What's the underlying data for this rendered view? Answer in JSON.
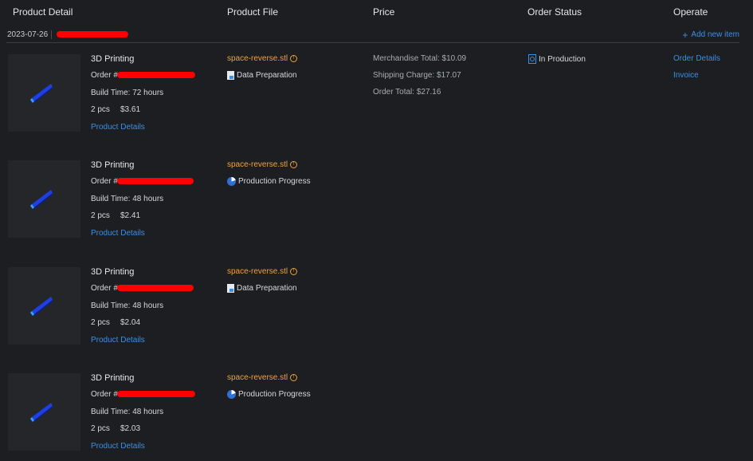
{
  "columns": {
    "product_detail": "Product Detail",
    "product_file": "Product File",
    "price": "Price",
    "order_status": "Order Status",
    "operate": "Operate"
  },
  "group": {
    "date": "2023-07-26",
    "add_item": "Add new item",
    "add_icon": "plus-icon"
  },
  "accent_color": "#3b8fe6",
  "file_color": "#f0a23a",
  "redaction_color": "#ff0000",
  "items": [
    {
      "title": "3D Printing",
      "order_label": "Order #:",
      "build_time": "Build Time: 72 hours",
      "quantity": "2 pcs",
      "unit_price": "$3.61",
      "details_link": "Product Details",
      "file_name": "space-reverse.stl",
      "file_status": "Data Preparation",
      "file_status_icon": "document-icon"
    },
    {
      "title": "3D Printing",
      "order_label": "Order #:",
      "build_time": "Build Time: 48 hours",
      "quantity": "2 pcs",
      "unit_price": "$2.41",
      "details_link": "Product Details",
      "file_name": "space-reverse.stl",
      "file_status": "Production Progress",
      "file_status_icon": "pie-chart-icon"
    },
    {
      "title": "3D Printing",
      "order_label": "Order #:",
      "build_time": "Build Time: 48 hours",
      "quantity": "2 pcs",
      "unit_price": "$2.04",
      "details_link": "Product Details",
      "file_name": "space-reverse.stl",
      "file_status": "Data Preparation",
      "file_status_icon": "document-icon"
    },
    {
      "title": "3D Printing",
      "order_label": "Order #:",
      "build_time": "Build Time: 48 hours",
      "quantity": "2 pcs",
      "unit_price": "$2.03",
      "details_link": "Product Details",
      "file_name": "space-reverse.stl",
      "file_status": "Production Progress",
      "file_status_icon": "pie-chart-icon"
    }
  ],
  "pricing": {
    "merchandise": "Merchandise Total: $10.09",
    "shipping": "Shipping Charge: $17.07",
    "total": "Order Total: $27.16"
  },
  "order_status": {
    "label": "In Production",
    "icon": "production-status-icon"
  },
  "operate": {
    "order_details": "Order Details",
    "invoice": "Invoice"
  }
}
